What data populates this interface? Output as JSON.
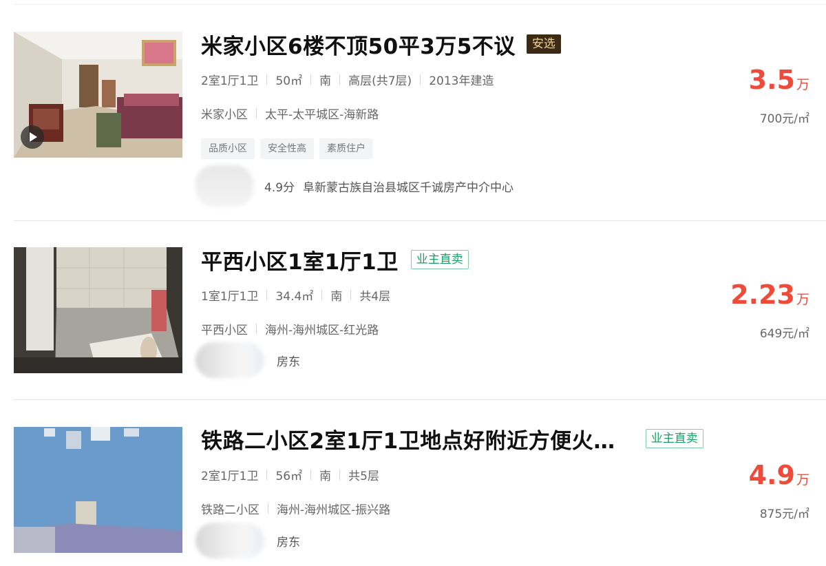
{
  "listings": [
    {
      "title": "米家小区6楼不顶50平3万5不议",
      "badge": "安选",
      "specs": [
        "2室1厅1卫",
        "50㎡",
        "南",
        "高层(共7层)",
        "2013年建造"
      ],
      "community": "米家小区",
      "location": "太平-太平城区-海新路",
      "tags": [
        "品质小区",
        "安全性高",
        "素质住户"
      ],
      "agent_score": "4.9分",
      "agent_company": "阜新蒙古族自治县城区千诚房产中介中心",
      "price": "3.5",
      "price_unit": "万",
      "unit_price": "700元/㎡"
    },
    {
      "title": "平西小区1室1厅1卫",
      "badge": "业主直卖",
      "specs": [
        "1室1厅1卫",
        "34.4㎡",
        "南",
        "共4层"
      ],
      "community": "平西小区",
      "location": "海州-海州城区-红光路",
      "owner_label": "房东",
      "price": "2.23",
      "price_unit": "万",
      "unit_price": "649元/㎡"
    },
    {
      "title": "铁路二小区2室1厅1卫地点好附近方便火…",
      "badge": "业主直卖",
      "specs": [
        "2室1厅1卫",
        "56㎡",
        "南",
        "共5层"
      ],
      "community": "铁路二小区",
      "location": "海州-海州城区-振兴路",
      "owner_label": "房东",
      "price": "4.9",
      "price_unit": "万",
      "unit_price": "875元/㎡"
    }
  ],
  "colors": {
    "price": "#f04b3a",
    "owner_badge": "#1aa066",
    "anxuan_badge_bg": "#3d2a14",
    "anxuan_badge_text": "#f1d38f"
  },
  "icons": {
    "video": "play-icon"
  }
}
